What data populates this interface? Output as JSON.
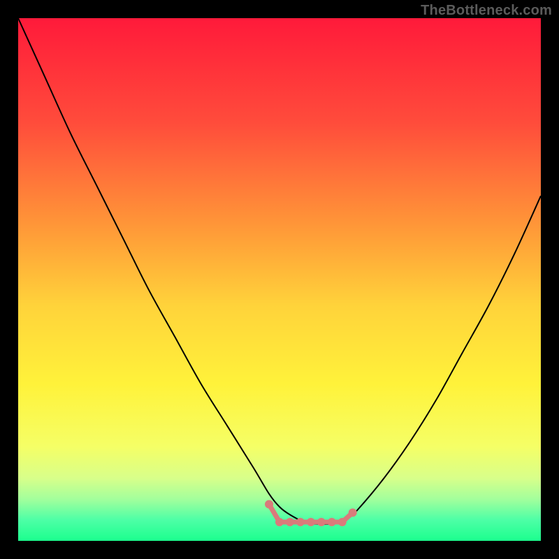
{
  "watermark": "TheBottleneck.com",
  "chart_data": {
    "type": "line",
    "title": "",
    "xlabel": "",
    "ylabel": "",
    "xlim": [
      0,
      100
    ],
    "ylim": [
      0,
      100
    ],
    "grid": false,
    "series": [
      {
        "name": "curve",
        "x": [
          0,
          5,
          10,
          15,
          20,
          25,
          30,
          35,
          40,
          45,
          48,
          50,
          52,
          55,
          58,
          61,
          63,
          65,
          70,
          75,
          80,
          85,
          90,
          95,
          100
        ],
        "y": [
          100,
          89,
          78,
          68,
          58,
          48,
          39,
          30,
          22,
          14,
          9,
          6.5,
          5,
          3.5,
          3.2,
          3.4,
          4.2,
          6,
          12,
          19,
          27,
          36,
          45,
          55,
          66
        ]
      }
    ],
    "background_gradient": {
      "stops": [
        {
          "pos": 0.0,
          "color": "#ff1a3a"
        },
        {
          "pos": 0.2,
          "color": "#ff4c3b"
        },
        {
          "pos": 0.4,
          "color": "#ff9838"
        },
        {
          "pos": 0.55,
          "color": "#ffd33a"
        },
        {
          "pos": 0.7,
          "color": "#fff23a"
        },
        {
          "pos": 0.82,
          "color": "#f5ff66"
        },
        {
          "pos": 0.88,
          "color": "#d8ff8a"
        },
        {
          "pos": 0.92,
          "color": "#a3ff9c"
        },
        {
          "pos": 0.96,
          "color": "#4dffa6"
        },
        {
          "pos": 1.0,
          "color": "#1cff8e"
        }
      ]
    },
    "trough_marker": {
      "color": "#d97b7b",
      "dot_radius": 6,
      "line_width": 7,
      "points_x": [
        48,
        50,
        52,
        54,
        56,
        58,
        60,
        62,
        64
      ],
      "y": 3.6,
      "end_y_left": 7.0,
      "end_y_right": 5.4
    }
  }
}
